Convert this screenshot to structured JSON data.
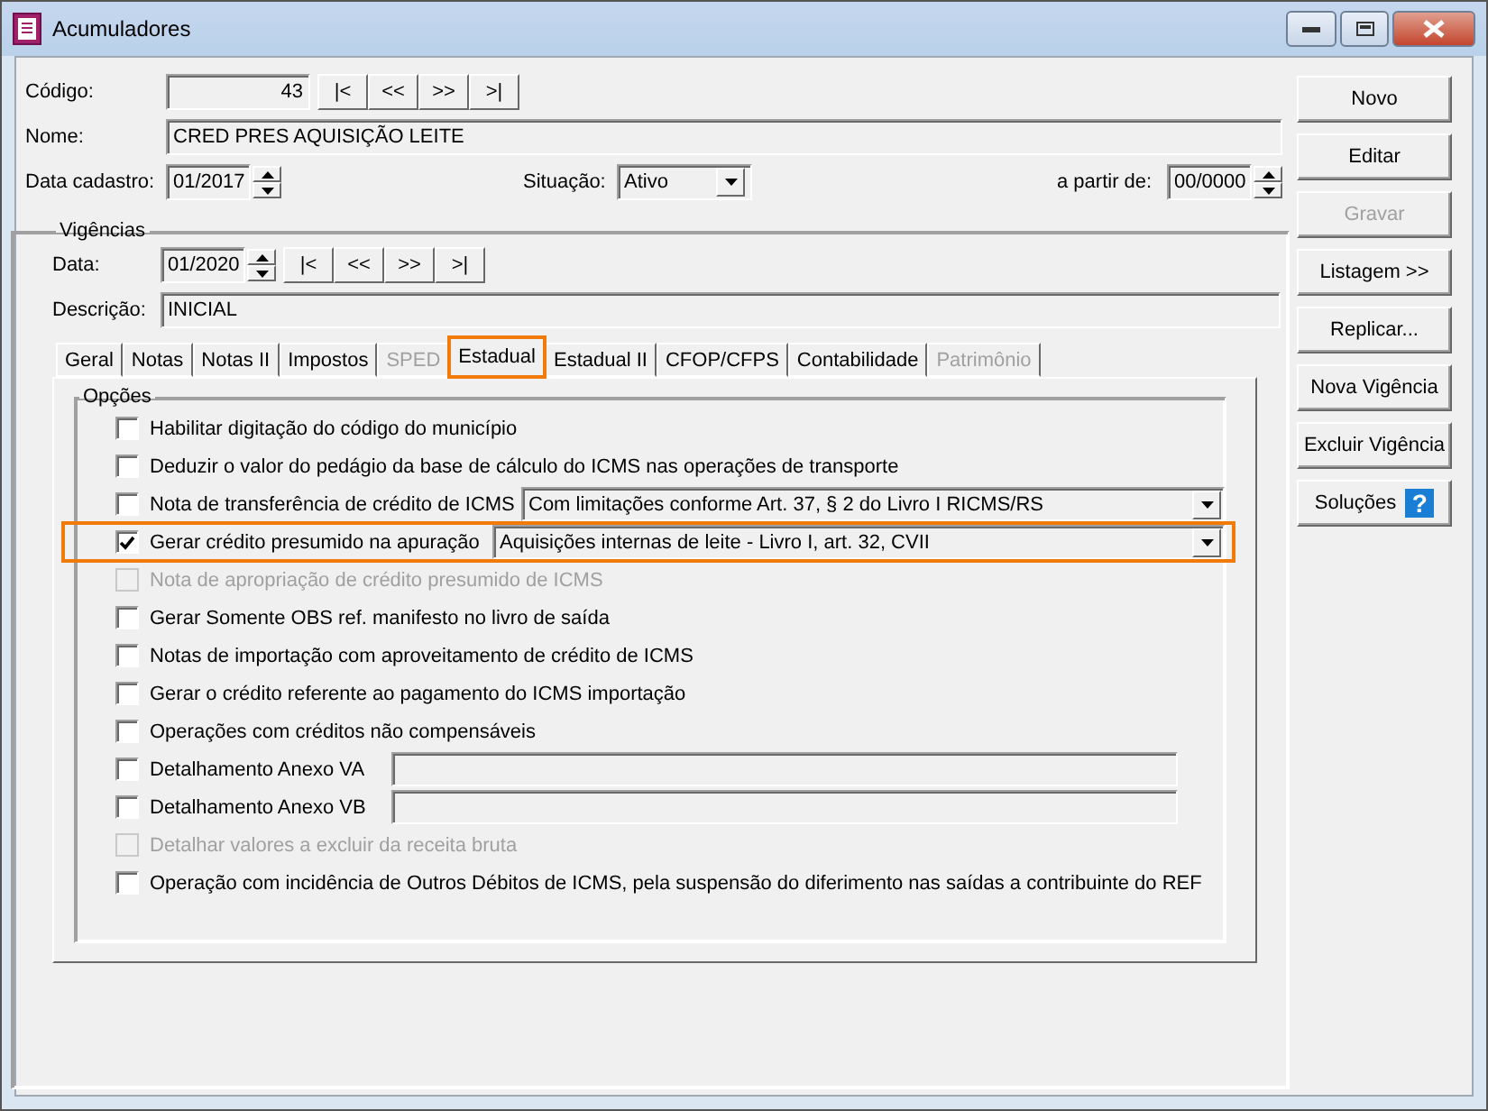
{
  "window": {
    "title": "Acumuladores"
  },
  "header": {
    "codigo": {
      "label": "Código:",
      "value": "43"
    },
    "nav_buttons": [
      "|<",
      "<<",
      ">>",
      ">|"
    ],
    "nome": {
      "label": "Nome:",
      "value": "CRED PRES AQUISIÇÃO LEITE"
    },
    "data_cadastro": {
      "label": "Data cadastro:",
      "value": "01/2017"
    },
    "situacao": {
      "label": "Situação:",
      "value": "Ativo"
    },
    "a_partir_de": {
      "label": "a partir de:",
      "value": "00/0000"
    }
  },
  "vigencias": {
    "title": "Vigências",
    "data": {
      "label": "Data:",
      "value": "01/2020"
    },
    "nav_buttons": [
      "|<",
      "<<",
      ">>",
      ">|"
    ],
    "descricao": {
      "label": "Descrição:",
      "value": "INICIAL"
    },
    "tabs": [
      {
        "label": "Geral",
        "selected": false,
        "disabled": false,
        "highlighted": false
      },
      {
        "label": "Notas",
        "selected": false,
        "disabled": false,
        "highlighted": false
      },
      {
        "label": "Notas II",
        "selected": false,
        "disabled": false,
        "highlighted": false
      },
      {
        "label": "Impostos",
        "selected": false,
        "disabled": false,
        "highlighted": false
      },
      {
        "label": "SPED",
        "selected": false,
        "disabled": true,
        "highlighted": false
      },
      {
        "label": "Estadual",
        "selected": true,
        "disabled": false,
        "highlighted": true
      },
      {
        "label": "Estadual II",
        "selected": false,
        "disabled": false,
        "highlighted": false
      },
      {
        "label": "CFOP/CFPS",
        "selected": false,
        "disabled": false,
        "highlighted": false
      },
      {
        "label": "Contabilidade",
        "selected": false,
        "disabled": false,
        "highlighted": false
      },
      {
        "label": "Patrimônio",
        "selected": false,
        "disabled": true,
        "highlighted": false
      }
    ],
    "opcoes": {
      "title": "Opções",
      "rows": [
        {
          "kind": "plain",
          "label": "Habilitar digitação do código do município",
          "checked": false,
          "disabled": false,
          "highlighted": false
        },
        {
          "kind": "plain",
          "label": "Deduzir o valor do pedágio da base de cálculo do ICMS nas operações de transporte",
          "checked": false,
          "disabled": false,
          "highlighted": false
        },
        {
          "kind": "select",
          "label": "Nota de transferência de crédito de ICMS",
          "value": "Com limitações conforme Art. 37, § 2 do Livro I RICMS/RS",
          "checked": false,
          "disabled": false,
          "highlighted": false
        },
        {
          "kind": "select",
          "label": "Gerar crédito presumido na apuração",
          "value": "Aquisições internas de leite - Livro I, art. 32, CVII",
          "checked": true,
          "disabled": false,
          "highlighted": true
        },
        {
          "kind": "plain",
          "label": "Nota de apropriação de crédito presumido de ICMS",
          "checked": false,
          "disabled": true,
          "highlighted": false
        },
        {
          "kind": "plain",
          "label": "Gerar Somente OBS ref. manifesto no livro de saída",
          "checked": false,
          "disabled": false,
          "highlighted": false
        },
        {
          "kind": "plain",
          "label": "Notas de importação com aproveitamento de crédito de ICMS",
          "checked": false,
          "disabled": false,
          "highlighted": false
        },
        {
          "kind": "plain",
          "label": "Gerar o crédito referente ao pagamento do ICMS importação",
          "checked": false,
          "disabled": false,
          "highlighted": false
        },
        {
          "kind": "plain",
          "label": "Operações com créditos não compensáveis",
          "checked": false,
          "disabled": false,
          "highlighted": false
        },
        {
          "kind": "text",
          "label": "Detalhamento Anexo VA",
          "checked": false,
          "disabled": false,
          "highlighted": false
        },
        {
          "kind": "text",
          "label": "Detalhamento Anexo VB",
          "checked": false,
          "disabled": false,
          "highlighted": false
        },
        {
          "kind": "plain",
          "label": "Detalhar valores a excluir da receita bruta",
          "checked": false,
          "disabled": true,
          "highlighted": false
        },
        {
          "kind": "plain",
          "label": "Operação com incidência de Outros Débitos de ICMS, pela suspensão do diferimento nas saídas a contribuinte do REF",
          "checked": false,
          "disabled": false,
          "highlighted": false
        }
      ]
    }
  },
  "side_buttons": [
    {
      "label": "Novo",
      "disabled": false,
      "kind": "plain"
    },
    {
      "label": "Editar",
      "disabled": false,
      "kind": "plain"
    },
    {
      "label": "Gravar",
      "disabled": true,
      "kind": "plain"
    },
    {
      "label": "Listagem >>",
      "disabled": false,
      "kind": "plain"
    },
    {
      "label": "Replicar...",
      "disabled": false,
      "kind": "plain"
    },
    {
      "label": "Nova Vigência",
      "disabled": false,
      "kind": "plain"
    },
    {
      "label": "Excluir Vigência",
      "disabled": false,
      "kind": "plain"
    },
    {
      "label": "Soluções",
      "disabled": false,
      "kind": "help",
      "icon_text": "?"
    }
  ]
}
